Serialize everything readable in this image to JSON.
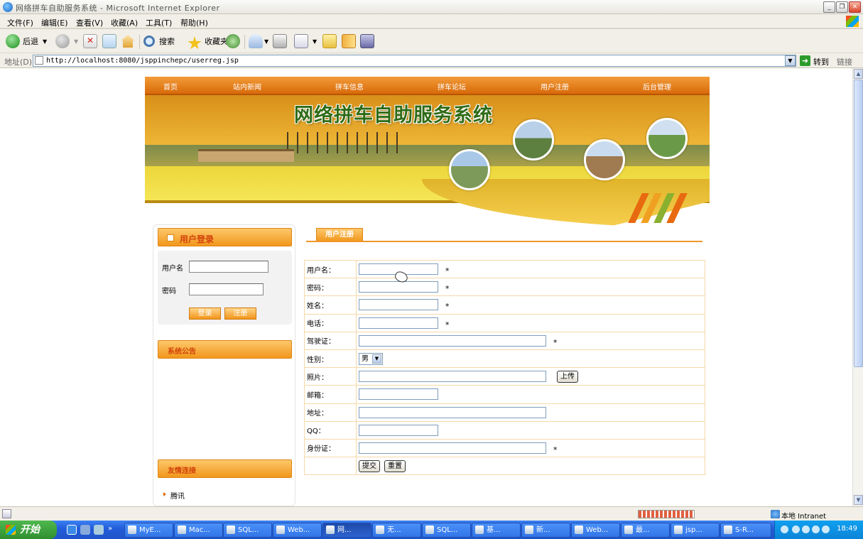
{
  "window": {
    "title": "网络拼车自助服务系统 - Microsoft Internet Explorer"
  },
  "menu": [
    "文件(F)",
    "编辑(E)",
    "查看(V)",
    "收藏(A)",
    "工具(T)",
    "帮助(H)"
  ],
  "toolbar": {
    "back": "后退",
    "search": "搜索",
    "favorites": "收藏夹"
  },
  "address": {
    "label": "地址(D)",
    "url": "http://localhost:8080/jsppinchepc/userreg.jsp",
    "go": "转到",
    "links": "链接"
  },
  "site": {
    "nav": [
      "首页",
      "站内新闻",
      "拼车信息",
      "拼车论坛",
      "用户注册",
      "后台管理"
    ],
    "banner_title": "网络拼车自助服务系统",
    "login": {
      "title": "用户登录",
      "username_label": "用户名",
      "password_label": "密码",
      "login_btn": "登录",
      "register_btn": "注册"
    },
    "notice_title": "系统公告",
    "links_title": "友情连接",
    "links": [
      "腾讯"
    ],
    "reg": {
      "tab": "用户注册",
      "required": "*",
      "fields": {
        "username": "用户名：",
        "password": "密码：",
        "name": "姓名：",
        "phone": "电话：",
        "license": "驾驶证：",
        "gender": "性别：",
        "photo": "照片：",
        "email": "邮箱：",
        "address": "地址：",
        "qq": "QQ：",
        "idcard": "身份证："
      },
      "gender_value": "男",
      "upload_btn": "上传",
      "submit_btn": "提交",
      "reset_btn": "重置"
    }
  },
  "status": {
    "zone": "本地 Intranet"
  },
  "taskbar": {
    "start": "开始",
    "tasks": [
      "MyE...",
      "Mac...",
      "SQL...",
      "Web...",
      "网...",
      "无...",
      "SQL...",
      "基...",
      "新...",
      "Web...",
      "最...",
      "jsp...",
      "S-R..."
    ],
    "clock": "18:49"
  }
}
